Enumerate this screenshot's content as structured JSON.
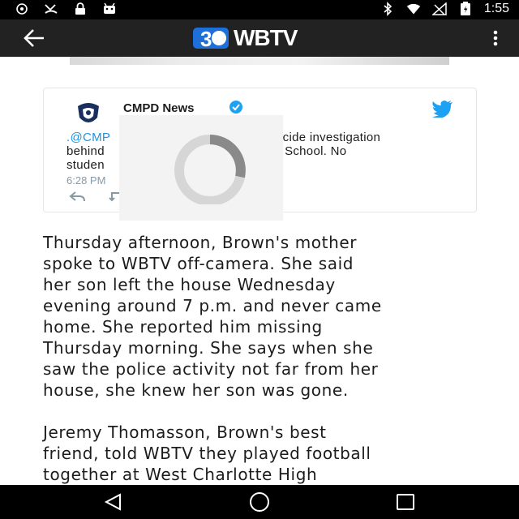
{
  "status_bar": {
    "time": "1:55",
    "icons_left": [
      "sync-icon",
      "missed-call-icon",
      "lock-icon",
      "android-icon"
    ],
    "icons_right": [
      "bluetooth-icon",
      "wifi-icon",
      "signal-icon",
      "battery-icon"
    ]
  },
  "app_bar": {
    "logo_text": "WBTV",
    "logo_mark": "3",
    "back_icon": "arrow-left-icon",
    "menu_icon": "more-vertical-icon"
  },
  "tweet": {
    "author_name": "CMPD News",
    "handle_fragment": ".@CMP",
    "line1_tail": "micide investigation",
    "line2_head": "behind",
    "line2_tail": "ary School. No",
    "line3_head": "studen",
    "time_fragment": "6:28 PM",
    "verified": true
  },
  "article": {
    "paragraph1": [
      "Thursday afternoon, Brown's mother",
      "spoke to WBTV off-camera. She said",
      "her son left the house Wednesday",
      "evening around 7 p.m. and never came",
      "home. She reported him missing",
      "Thursday morning. She says when she",
      "saw the police activity not far from her",
      "house, she knew her son was gone."
    ],
    "paragraph2": [
      "Jeremy Thomasson, Brown's best",
      "friend, told WBTV they played football",
      "together at West Charlotte High"
    ]
  },
  "colors": {
    "app_bar": "#222222",
    "status_bar": "#000000",
    "link": "#1b95e0",
    "logo_blue": "#1e6fd9",
    "twitter_blue": "#1da1f2"
  }
}
